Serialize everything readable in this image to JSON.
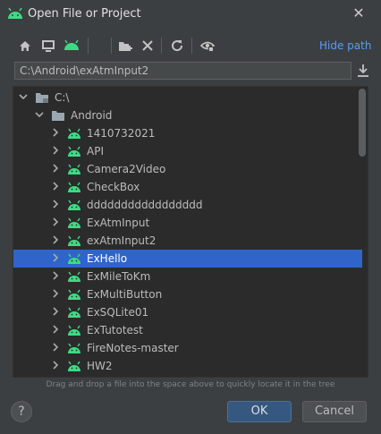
{
  "window": {
    "title": "Open File or Project",
    "close_icon": "close-icon"
  },
  "toolbar": {
    "buttons": [
      "home-icon",
      "desktop-icon",
      "android-project-icon",
      "new-folder-icon",
      "delete-icon",
      "refresh-icon",
      "show-hidden-icon"
    ],
    "hide_path_label": "Hide path"
  },
  "path": {
    "value": "C:\\Android\\exAtmInput2"
  },
  "tree": {
    "items": [
      {
        "label": "C:\\",
        "type": "drive",
        "expanded": true,
        "level": 0
      },
      {
        "label": "Android",
        "type": "folder",
        "expanded": true,
        "level": 1
      },
      {
        "label": "1410732021",
        "type": "android",
        "level": 2
      },
      {
        "label": "API",
        "type": "android",
        "level": 2
      },
      {
        "label": "Camera2Video",
        "type": "android",
        "level": 2
      },
      {
        "label": "CheckBox",
        "type": "android",
        "level": 2
      },
      {
        "label": "ddddddddddddddddd",
        "type": "android",
        "level": 2
      },
      {
        "label": "ExAtmInput",
        "type": "android",
        "level": 2
      },
      {
        "label": "exAtmInput2",
        "type": "android",
        "level": 2
      },
      {
        "label": "ExHello",
        "type": "android",
        "level": 2,
        "selected": true
      },
      {
        "label": "ExMileToKm",
        "type": "android",
        "level": 2
      },
      {
        "label": "ExMultiButton",
        "type": "android",
        "level": 2
      },
      {
        "label": "ExSQLite01",
        "type": "android",
        "level": 2
      },
      {
        "label": "ExTutotest",
        "type": "android",
        "level": 2
      },
      {
        "label": "FireNotes-master",
        "type": "android",
        "level": 2
      },
      {
        "label": "HW2",
        "type": "android",
        "level": 2
      }
    ]
  },
  "hint": "Drag and drop a file into the space above to quickly locate it in the tree",
  "footer": {
    "help_label": "?",
    "ok_label": "OK",
    "cancel_label": "Cancel"
  },
  "colors": {
    "background": "#3c3f41",
    "tree_background": "#2b2b2b",
    "selection": "#2f65ca",
    "android_green": "#3ddc84",
    "link": "#589df6"
  }
}
